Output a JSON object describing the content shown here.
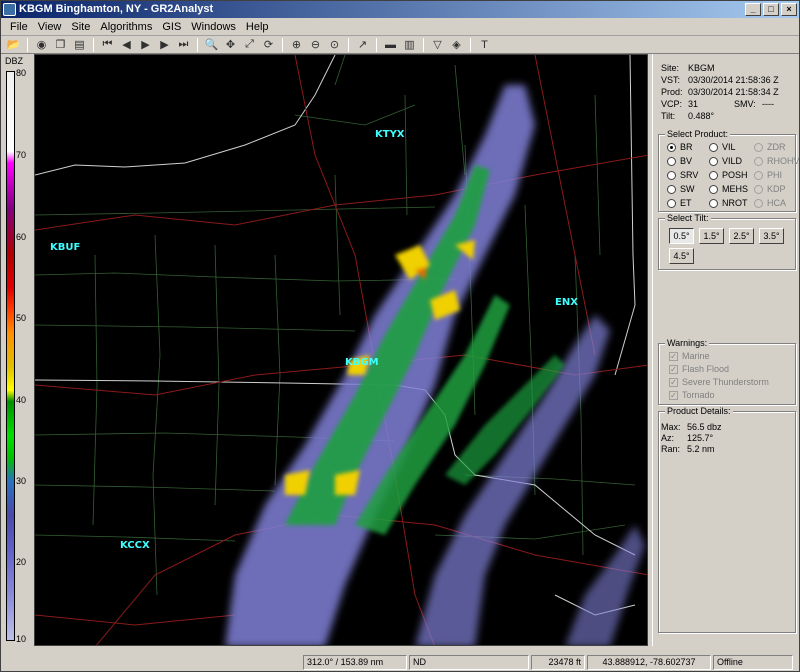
{
  "window": {
    "title": "KBGM Binghamton, NY - GR2Analyst",
    "min": "_",
    "max": "□",
    "close": "×"
  },
  "menu": [
    "File",
    "View",
    "Site",
    "Algorithms",
    "GIS",
    "Windows",
    "Help"
  ],
  "toolbar_icons": [
    "open-icon",
    "globe-icon",
    "copy-icon",
    "save-icon",
    "first-frame-icon",
    "prev-frame-icon",
    "play-icon",
    "next-frame-icon",
    "last-frame-icon",
    "magnify-icon",
    "pan-icon",
    "measure-icon",
    "rotate-icon",
    "zoom-in-icon",
    "zoom-out-icon",
    "zoom-reset-icon",
    "pointer-icon",
    "bar-icon",
    "split-icon",
    "warning-icon",
    "diamond-icon",
    "text-icon"
  ],
  "colorbar": {
    "unit": "DBZ",
    "ticks": [
      "80",
      "70",
      "60",
      "50",
      "40",
      "30",
      "20",
      "10"
    ]
  },
  "map": {
    "sites": [
      {
        "name": "KTYX"
      },
      {
        "name": "KBUF"
      },
      {
        "name": "ENX"
      },
      {
        "name": "KBGM"
      },
      {
        "name": "KCCX"
      }
    ]
  },
  "info": {
    "site_label": "Site:",
    "site": "KBGM",
    "vst_label": "VST:",
    "vst": "03/30/2014 21:58:36 Z",
    "prod_label": "Prod:",
    "prod": "03/30/2014 21:58:34 Z",
    "vcp_label": "VCP:",
    "vcp": "31",
    "smv_label": "SMV:",
    "smv": "----",
    "tilt_label": "Tilt:",
    "tilt": "0.488°"
  },
  "select_product": {
    "title": "Select Product:",
    "left": [
      "BR",
      "BV",
      "SRV",
      "SW",
      "ET"
    ],
    "middle": [
      "VIL",
      "VILD",
      "POSH",
      "MEHS",
      "NROT"
    ],
    "right": [
      "ZDR",
      "RHOHV",
      "PHI",
      "KDP",
      "HCA"
    ],
    "selected": "BR"
  },
  "select_tilt": {
    "title": "Select Tilt:",
    "tilts": [
      "0.5°",
      "1.5°",
      "2.5°",
      "3.5°",
      "4.5°"
    ],
    "selected": "0.5°"
  },
  "warnings": {
    "title": "Warnings:",
    "items": [
      "Marine",
      "Flash Flood",
      "Severe Thunderstorm",
      "Tornado"
    ]
  },
  "product_details": {
    "title": "Product Details:",
    "max_label": "Max:",
    "max": "56.5 dbz",
    "az_label": "Az:",
    "az": "125.7°",
    "ran_label": "Ran:",
    "ran": "5.2 nm"
  },
  "status": {
    "polar": "312.0° / 153.89 nm",
    "nd": "ND",
    "height": "23478 ft",
    "coords": "43.888912, -78.602737",
    "mode": "Offline"
  }
}
